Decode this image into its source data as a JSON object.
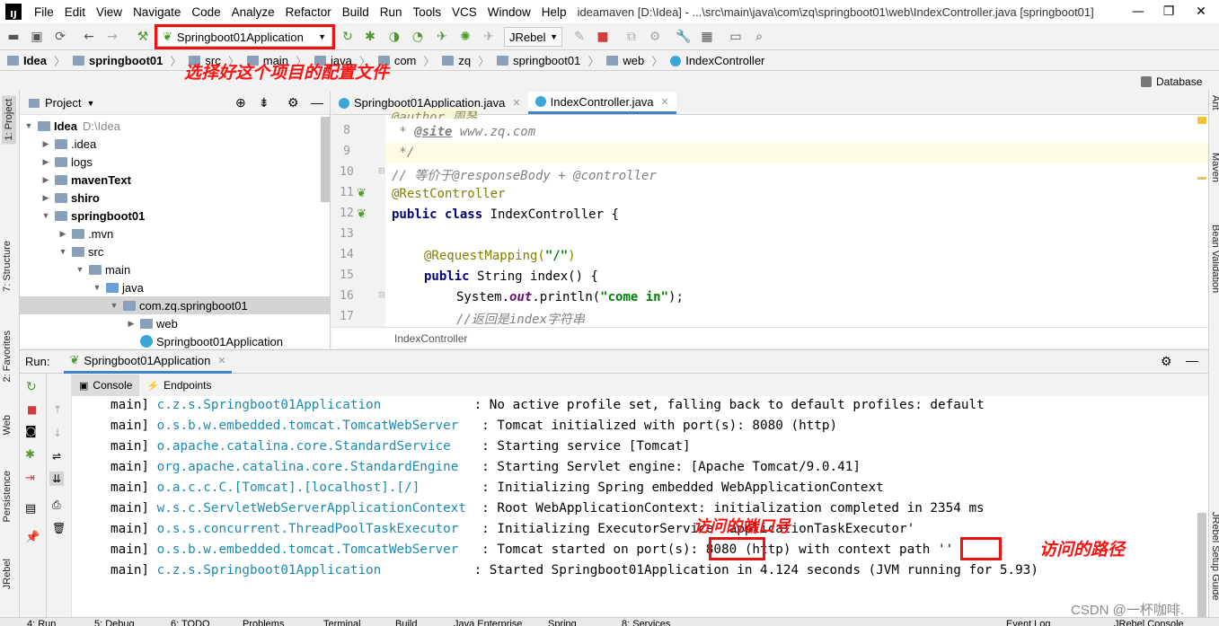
{
  "titlebar": {
    "logo": "IJ",
    "menu": [
      "File",
      "Edit",
      "View",
      "Navigate",
      "Code",
      "Analyze",
      "Refactor",
      "Build",
      "Run",
      "Tools",
      "VCS",
      "Window",
      "Help"
    ],
    "title": "ideamaven [D:\\Idea] - ...\\src\\main\\java\\com\\zq\\springboot01\\web\\IndexController.java [springboot01]"
  },
  "toolbar": {
    "run_config": "Springboot01Application",
    "jrebel": "JRebel"
  },
  "breadcrumbs": [
    "Idea",
    "springboot01",
    "src",
    "main",
    "java",
    "com",
    "zq",
    "springboot01",
    "web",
    "IndexController"
  ],
  "database_tab": "Database",
  "left_tabs": [
    "1: Project",
    "7: Structure",
    "2: Favorites",
    "Web",
    "Persistence",
    "JRebel"
  ],
  "right_tabs": [
    "Ant",
    "Maven",
    "Bean Validation",
    "JRebel Setup Guide"
  ],
  "project": {
    "header": "Project",
    "tree": [
      {
        "label": "Idea",
        "extra": "D:\\Idea",
        "bold": true,
        "depth": 0,
        "arrow": "▼"
      },
      {
        "label": ".idea",
        "depth": 1,
        "arrow": "▶"
      },
      {
        "label": "logs",
        "depth": 1,
        "arrow": "▶"
      },
      {
        "label": "mavenText",
        "depth": 1,
        "arrow": "▶",
        "bold": true
      },
      {
        "label": "shiro",
        "depth": 1,
        "arrow": "▶",
        "bold": true
      },
      {
        "label": "springboot01",
        "depth": 1,
        "arrow": "▼",
        "bold": true
      },
      {
        "label": ".mvn",
        "depth": 2,
        "arrow": "▶"
      },
      {
        "label": "src",
        "depth": 2,
        "arrow": "▼"
      },
      {
        "label": "main",
        "depth": 3,
        "arrow": "▼"
      },
      {
        "label": "java",
        "depth": 4,
        "arrow": "▼"
      },
      {
        "label": "com.zq.springboot01",
        "depth": 5,
        "arrow": "▼"
      },
      {
        "label": "web",
        "depth": 6,
        "arrow": "▶"
      },
      {
        "label": "Springboot01Application",
        "depth": 6,
        "arrow": ""
      }
    ]
  },
  "editor": {
    "tabs": [
      "Springboot01Application.java",
      "IndexController.java"
    ],
    "line_numbers": [
      "8",
      "9",
      "10",
      "11",
      "12",
      "13",
      "14",
      "15",
      "16",
      "17"
    ],
    "code": {
      "l7": "@author 周琴",
      "l8a": " * ",
      "l8b": "@site",
      "l8c": " www.zq.com",
      "l9": " */",
      "l10": "// 等价于@responseBody + @controller",
      "l11": "@RestController",
      "l12a": "public class ",
      "l12b": "IndexController {",
      "l14a": "@RequestMapping(",
      "l14b": "\"/\"",
      "l14c": ")",
      "l15a": "public ",
      "l15b": "String index() {",
      "l16a": "System.",
      "l16b": "out",
      "l16c": ".println(",
      "l16d": "\"come in\"",
      "l16e": ");",
      "l17": "//返回是index字符串"
    },
    "footer": "IndexController"
  },
  "run": {
    "label": "Run:",
    "tab": "Springboot01Application",
    "console_tab": "Console",
    "endpoints_tab": "Endpoints"
  },
  "console": [
    {
      "thread": "main]",
      "logger": "c.z.s.Springboot01Application           ",
      "msg": ": No active profile set, falling back to default profiles: default"
    },
    {
      "thread": "main]",
      "logger": "o.s.b.w.embedded.tomcat.TomcatWebServer  ",
      "msg": ": Tomcat initialized with port(s): 8080 (http)"
    },
    {
      "thread": "main]",
      "logger": "o.apache.catalina.core.StandardService   ",
      "msg": ": Starting service [Tomcat]"
    },
    {
      "thread": "main]",
      "logger": "org.apache.catalina.core.StandardEngine  ",
      "msg": ": Starting Servlet engine: [Apache Tomcat/9.0.41]"
    },
    {
      "thread": "main]",
      "logger": "o.a.c.c.C.[Tomcat].[localhost].[/]       ",
      "msg": ": Initializing Spring embedded WebApplicationContext"
    },
    {
      "thread": "main]",
      "logger": "w.s.c.ServletWebServerApplicationContext ",
      "msg": ": Root WebApplicationContext: initialization completed in 2354 ms"
    },
    {
      "thread": "main]",
      "logger": "o.s.s.concurrent.ThreadPoolTaskExecutor  ",
      "msg": ": Initializing ExecutorService 'applicationTaskExecutor'"
    },
    {
      "thread": "main]",
      "logger": "o.s.b.w.embedded.tomcat.TomcatWebServer  ",
      "msg": ": Tomcat started on port(s): 8080 (http) with context path ''"
    },
    {
      "thread": "main]",
      "logger": "c.z.s.Springboot01Application           ",
      "msg": ": Started Springboot01Application in 4.124 seconds (JVM running for 5.93)"
    }
  ],
  "annotations": {
    "config": "选择好这个项目的配置文件",
    "port": "访问的端口号",
    "path": "访问的路径"
  },
  "statusbar": [
    "4: Run",
    "5: Debug",
    "6: TODO",
    "Problems",
    "Terminal",
    "Build",
    "Java Enterprise",
    "Spring",
    "8: Services",
    "Event Log",
    "JRebel Console"
  ],
  "watermark": "CSDN @一杯咖啡.",
  "colors": {
    "annotation": "#ff1111",
    "accent": "#4083c9",
    "logger": "#1a8ab4"
  }
}
